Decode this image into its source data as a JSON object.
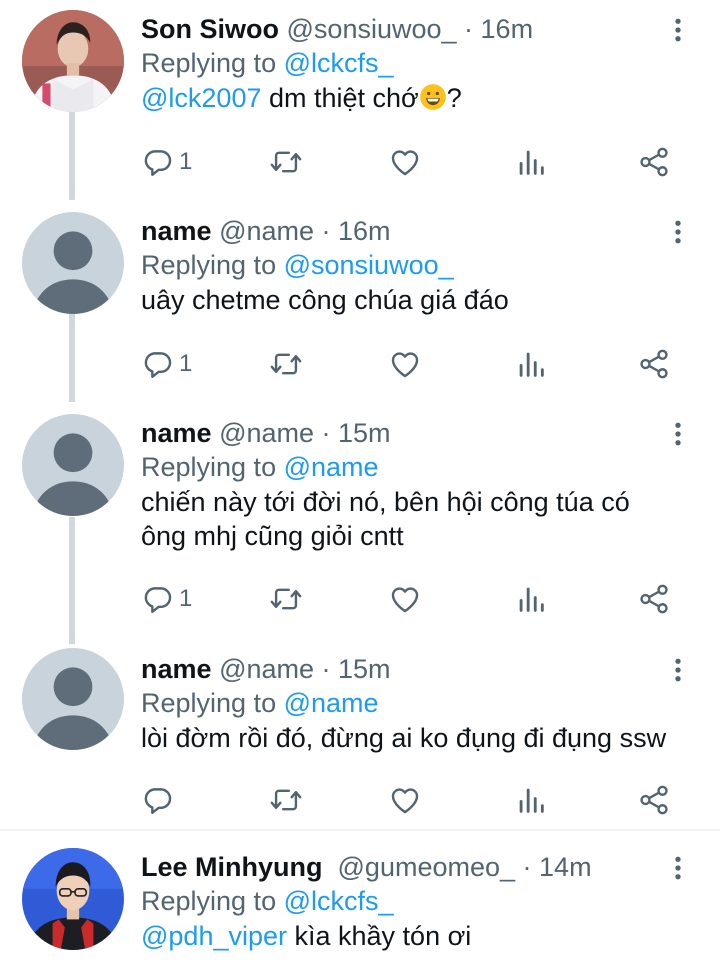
{
  "tweets": [
    {
      "display_name": "Son Siwoo",
      "handle": "@sonsiuwoo_",
      "time": "· 16m",
      "replying_label": "Replying to",
      "replying_to": "@lckcfs_",
      "mention": "@lck2007",
      "text": " dm thiệt chớ",
      "text_after": "?",
      "avatar": "photo-person-white-jacket",
      "reply_count": "1"
    },
    {
      "display_name": "name",
      "handle": "@name",
      "time": "· 16m",
      "replying_label": "Replying to",
      "replying_to": "@sonsiuwoo_",
      "text": "uây chetme công chúa giá đáo",
      "avatar": "default-avatar",
      "reply_count": "1"
    },
    {
      "display_name": "name",
      "handle": "@name",
      "time": "· 15m",
      "replying_label": "Replying to",
      "replying_to": "@name",
      "text": "chiến này tới đời nó, bên hội công túa có ông mhj cũng giỏi cntt",
      "avatar": "default-avatar",
      "reply_count": "1"
    },
    {
      "display_name": "name",
      "handle": "@name",
      "time": "· 15m",
      "replying_label": "Replying to",
      "replying_to": "@name",
      "text": "lòi đờm rồi đó, đừng ai ko đụng đi đụng ssw",
      "avatar": "default-avatar",
      "reply_count": ""
    },
    {
      "display_name": "Lee Minhyung",
      "handle": "@gumeomeo_",
      "time": "· 14m",
      "replying_label": "Replying to",
      "replying_to": "@lckcfs_",
      "mention": "@pdh_viper",
      "text": " kìa khầy tón ơi",
      "avatar": "photo-person-glasses",
      "reply_count": ""
    }
  ],
  "icons": {
    "reply": "reply-icon",
    "retweet": "retweet-icon",
    "like": "heart-icon",
    "views": "analytics-icon",
    "share": "share-icon",
    "more": "more-vertical-icon",
    "emoji": "grinning-face-emoji"
  },
  "colors": {
    "link": "#1d9bf0",
    "secondary": "#536471",
    "icon": "#536471",
    "thread_line": "#cfd9de",
    "default_avatar_bg": "#c8d3db",
    "default_avatar_fg": "#5e6d79"
  }
}
